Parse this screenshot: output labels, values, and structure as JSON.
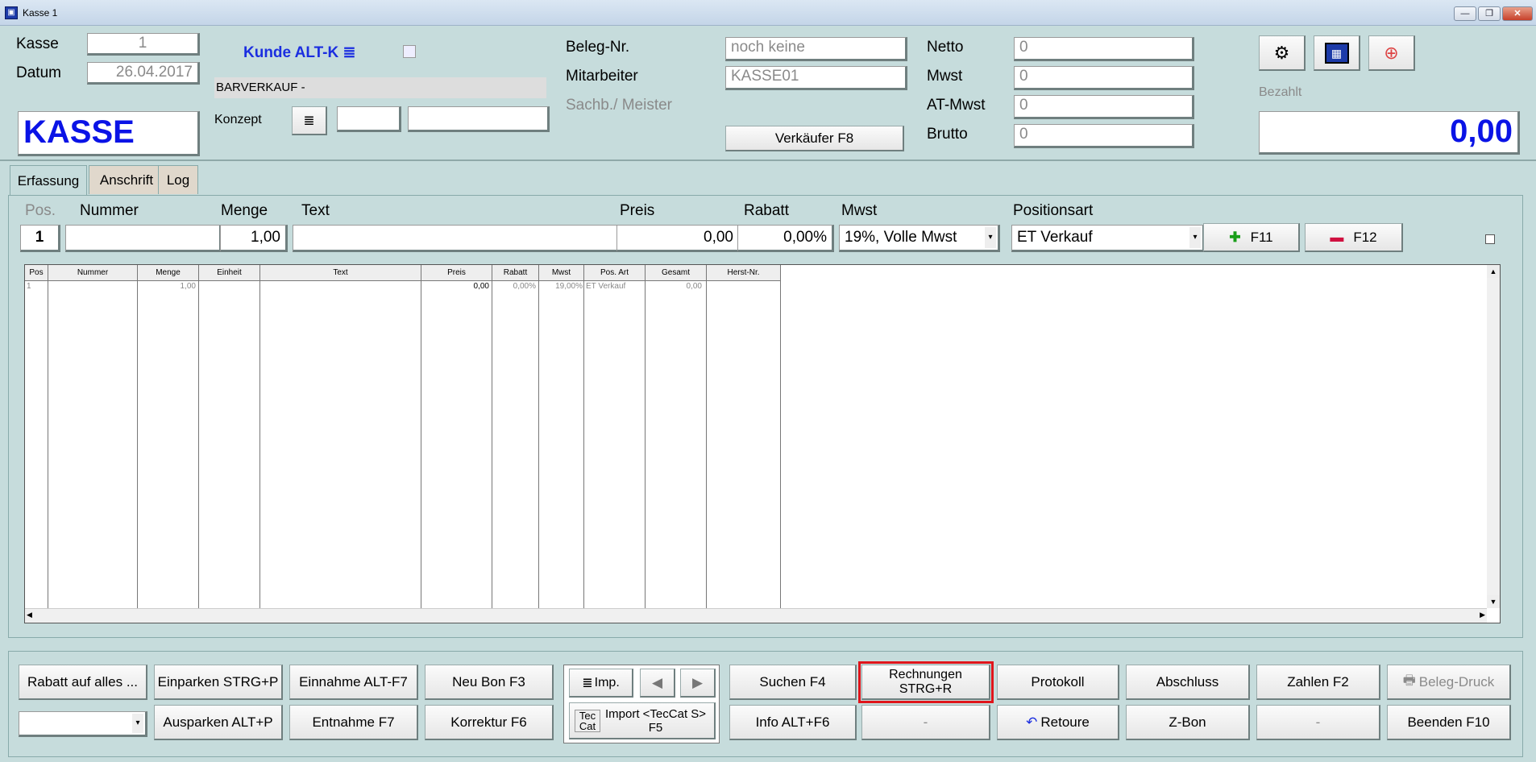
{
  "window": {
    "title": "Kasse 1"
  },
  "header": {
    "kasse_label": "Kasse",
    "kasse_value": "1",
    "datum_label": "Datum",
    "datum_value": "26.04.2017",
    "big_title": "KASSE",
    "kunde_label": "Kunde ALT-K",
    "kunde_name": "BARVERKAUF -",
    "konzept_label": "Konzept",
    "beleg_label": "Beleg-Nr.",
    "beleg_value": "noch keine",
    "mitarbeiter_label": "Mitarbeiter",
    "mitarbeiter_value": "KASSE01",
    "sachb_label": "Sachb./ Meister",
    "verkaeufer_button": "Verkäufer F8",
    "netto_label": "Netto",
    "netto_value": "0",
    "mwst_label": "Mwst",
    "mwst_value": "0",
    "atmwst_label": "AT-Mwst",
    "atmwst_value": "0",
    "brutto_label": "Brutto",
    "brutto_value": "0",
    "bezahlt_label": "Bezahlt",
    "bezahlt_value": "0,00"
  },
  "tabs": [
    {
      "label": "Erfassung"
    },
    {
      "label": "Anschrift"
    },
    {
      "label": "Log"
    }
  ],
  "entry": {
    "labels": {
      "pos": "Pos.",
      "nummer": "Nummer",
      "menge": "Menge",
      "text": "Text",
      "preis": "Preis",
      "rabatt": "Rabatt",
      "mwst": "Mwst",
      "positionsart": "Positionsart"
    },
    "values": {
      "pos": "1",
      "nummer": "",
      "menge": "1,00",
      "text": "",
      "preis": "0,00",
      "rabatt": "0,00%",
      "mwst": "19%, Volle Mwst",
      "positionsart": "ET Verkauf"
    },
    "add_button": "F11",
    "remove_button": "F12"
  },
  "grid": {
    "headers": [
      "Pos",
      "Nummer",
      "Menge",
      "Einheit",
      "Text",
      "Preis",
      "Rabatt",
      "Mwst",
      "Pos. Art",
      "Gesamt",
      "Herst-Nr."
    ],
    "row": [
      "1",
      "",
      "1,00",
      "",
      "",
      "0,00",
      "0,00%",
      "19,00%",
      "ET Verkauf",
      "0,00",
      ""
    ]
  },
  "buttons": {
    "rabatt": "Rabatt auf alles ...",
    "einparken": "Einparken STRG+P",
    "einnahme": "Einnahme ALT-F7",
    "neubon": "Neu Bon F3",
    "imp": "Imp.",
    "suchen": "Suchen F4",
    "rechnungen": "Rechnungen STRG+R",
    "protokoll": "Protokoll",
    "abschluss": "Abschluss",
    "zahlen": "Zahlen F2",
    "belegdruck": "Beleg-Druck",
    "ausparken": "Ausparken ALT+P",
    "entnahme": "Entnahme F7",
    "korrektur": "Korrektur F6",
    "tecc_import": "Import <TecCat S>",
    "tecc_key": "F5",
    "tecc_logo_top": "Tec",
    "tecc_logo_bottom": "Cat",
    "info": "Info ALT+F6",
    "dash1": "-",
    "retoure": "Retoure",
    "zbon": "Z-Bon",
    "dash2": "-",
    "beenden": "Beenden F10"
  },
  "colors": {
    "highlight": "#e0151b",
    "bigtext": "#0a13e6"
  }
}
